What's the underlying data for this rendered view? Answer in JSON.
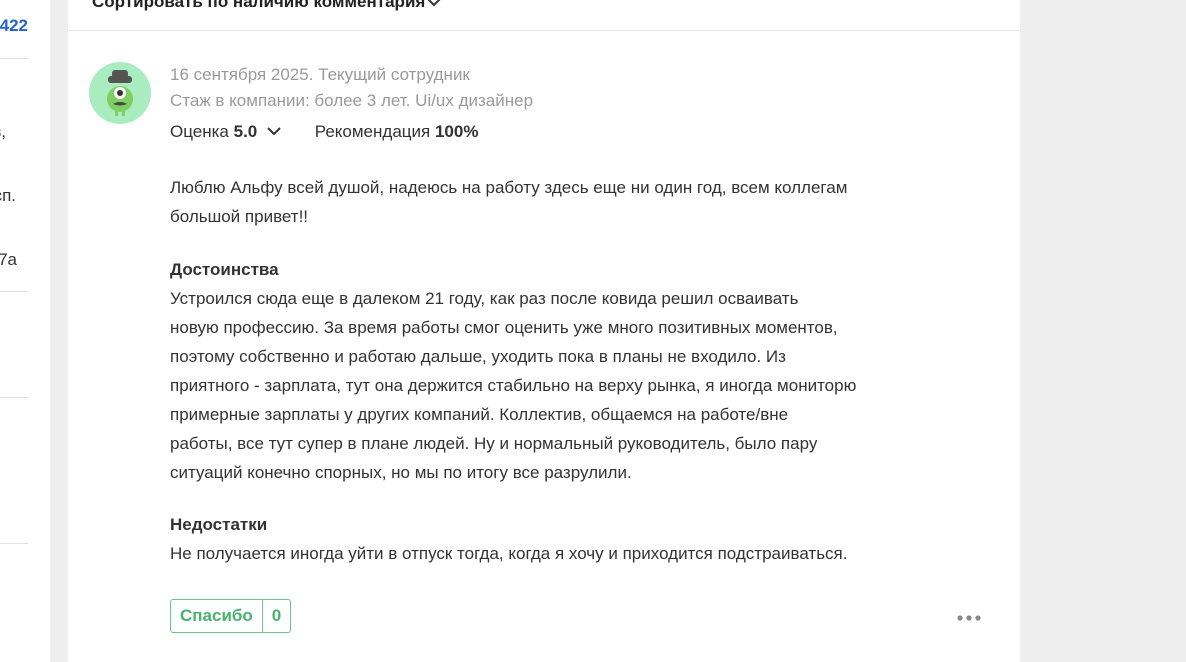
{
  "left_column": {
    "fragments": [
      "422",
      "з,",
      "сп.",
      "7а"
    ]
  },
  "sort": {
    "label": "Сортировать по наличию комментария"
  },
  "review": {
    "date_status": "16 сентября 2025. Текущий сотрудник",
    "tenure_role": "Стаж в компании: более 3 лет. Ui/ux дизайнер",
    "rating_label": "Оценка",
    "rating_value": "5.0",
    "recommend_label": "Рекомендация",
    "recommend_value": "100%",
    "summary_lines": [
      "Люблю Альфу всей душой, надеюсь на работу здесь еще ни один год, всем коллегам",
      "большой привет!!"
    ],
    "pros_title": "Достоинства",
    "pros_lines": [
      "Устроился сюда еще в далеком 21 году, как раз после ковида решил осваивать",
      "новую профессию. За время работы смог оценить уже много позитивных моментов,",
      "поэтому собственно и работаю дальше, уходить пока в планы не входило. Из",
      "приятного - зарплата, тут она держится стабильно на верху рынка, я иногда мониторю",
      "примерные зарплаты у других компаний. Коллектив, общаемся на работе/вне",
      "работы, все тут супер в плане людей. Ну и нормальный руководитель, было пару",
      "ситуаций конечно спорных, но мы по итогу все разрулили."
    ],
    "cons_title": "Недостатки",
    "cons_lines": [
      "Не получается иногда уйти в отпуск тогда, когда я хочу и приходится подстраиваться."
    ],
    "thanks_label": "Спасибо",
    "thanks_count": "0"
  },
  "colors": {
    "accent_green": "#47b36c",
    "link_blue": "#2462d1",
    "muted_text": "#9a9a9a"
  },
  "icons": [
    "chevron-down-icon",
    "avatar-mascot-icon",
    "more-dots-icon"
  ]
}
